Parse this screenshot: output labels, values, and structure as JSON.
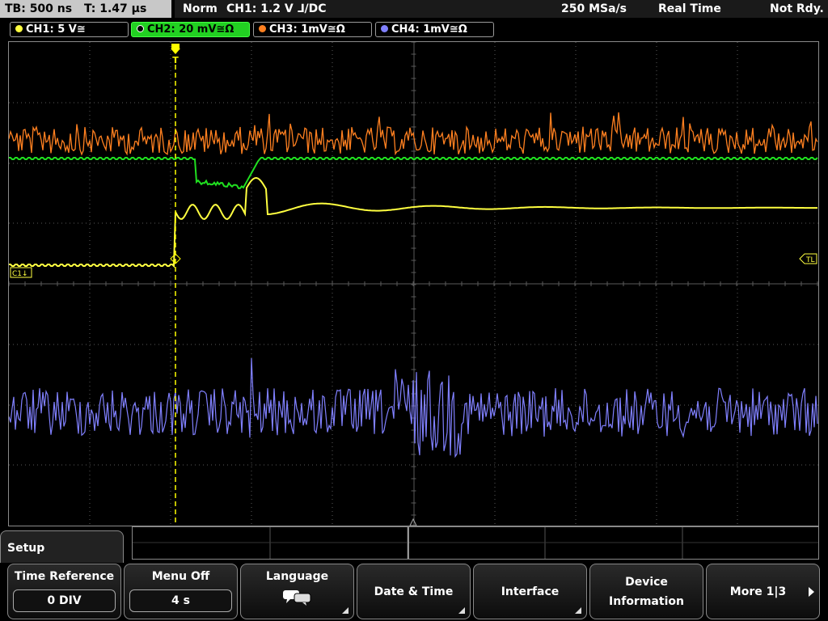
{
  "top": {
    "timebase": "TB: 500 ns",
    "trigger_time": "T: 1.47 µs",
    "mode": "Norm",
    "trigger_info": "CH1: 1.2 V ⅃/DC",
    "sample_rate": "250 MSa/s",
    "acq_mode": "Real Time",
    "status": "Not Rdy."
  },
  "channels": [
    {
      "label": "CH1: 5 V≅",
      "color": "#ffff40"
    },
    {
      "label": "CH2: 20 mV≅Ω",
      "color": "#20e020"
    },
    {
      "label": "CH3: 1mV≅Ω",
      "color": "#ff8020"
    },
    {
      "label": "CH4: 1mV≅Ω",
      "color": "#8080ff"
    }
  ],
  "markers": {
    "ch1": "C1↓",
    "trigger_level": "TL",
    "trigger_pos": "T"
  },
  "menu": {
    "title": "Setup",
    "softkeys": [
      {
        "label": "Time Reference",
        "value": "0 DIV"
      },
      {
        "label": "Menu Off",
        "value": "4 s"
      },
      {
        "label": "Language",
        "icon": "speech-bubbles-icon"
      },
      {
        "label": "Date & Time"
      },
      {
        "label": "Interface"
      },
      {
        "line1": "Device",
        "line2": "Information"
      },
      {
        "label": "More 1|3"
      }
    ]
  },
  "colors": {
    "ch1": "#ffff40",
    "ch2": "#20e020",
    "ch3": "#ff8020",
    "ch4": "#8080ff",
    "grid": "#5a5a5a",
    "trigger": "#ffff00"
  }
}
